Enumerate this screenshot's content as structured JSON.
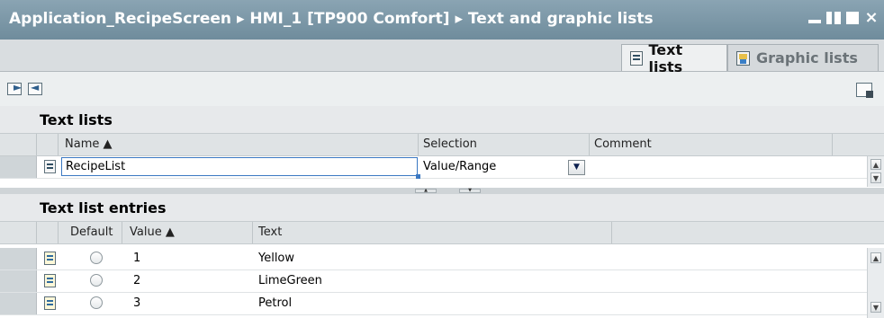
{
  "window": {
    "title": "Application_RecipeScreen  ▸  HMI_1 [TP900 Comfort]  ▸  Text and graphic lists",
    "controls": [
      "minimize",
      "float",
      "maximize",
      "close"
    ]
  },
  "tabs": [
    {
      "label": "Text lists",
      "icon": "text-list-icon",
      "active": true
    },
    {
      "label": "Graphic lists",
      "icon": "graphic-list-icon",
      "active": false
    }
  ],
  "toolbar": {
    "left_icons": [
      "insert-entry-icon",
      "import-icon"
    ],
    "right_icon": "export-window-icon"
  },
  "text_lists": {
    "title": "Text lists",
    "columns": {
      "name": "Name ▲",
      "selection": "Selection",
      "comment": "Comment"
    },
    "rows": [
      {
        "name": "RecipeList",
        "selection": "Value/Range",
        "comment": ""
      }
    ]
  },
  "text_list_entries": {
    "title": "Text list entries",
    "columns": {
      "default": "Default",
      "value": "Value ▲",
      "text": "Text"
    },
    "rows": [
      {
        "value": "1",
        "text": "Yellow"
      },
      {
        "value": "2",
        "text": "LimeGreen"
      },
      {
        "value": "3",
        "text": "Petrol"
      }
    ]
  }
}
